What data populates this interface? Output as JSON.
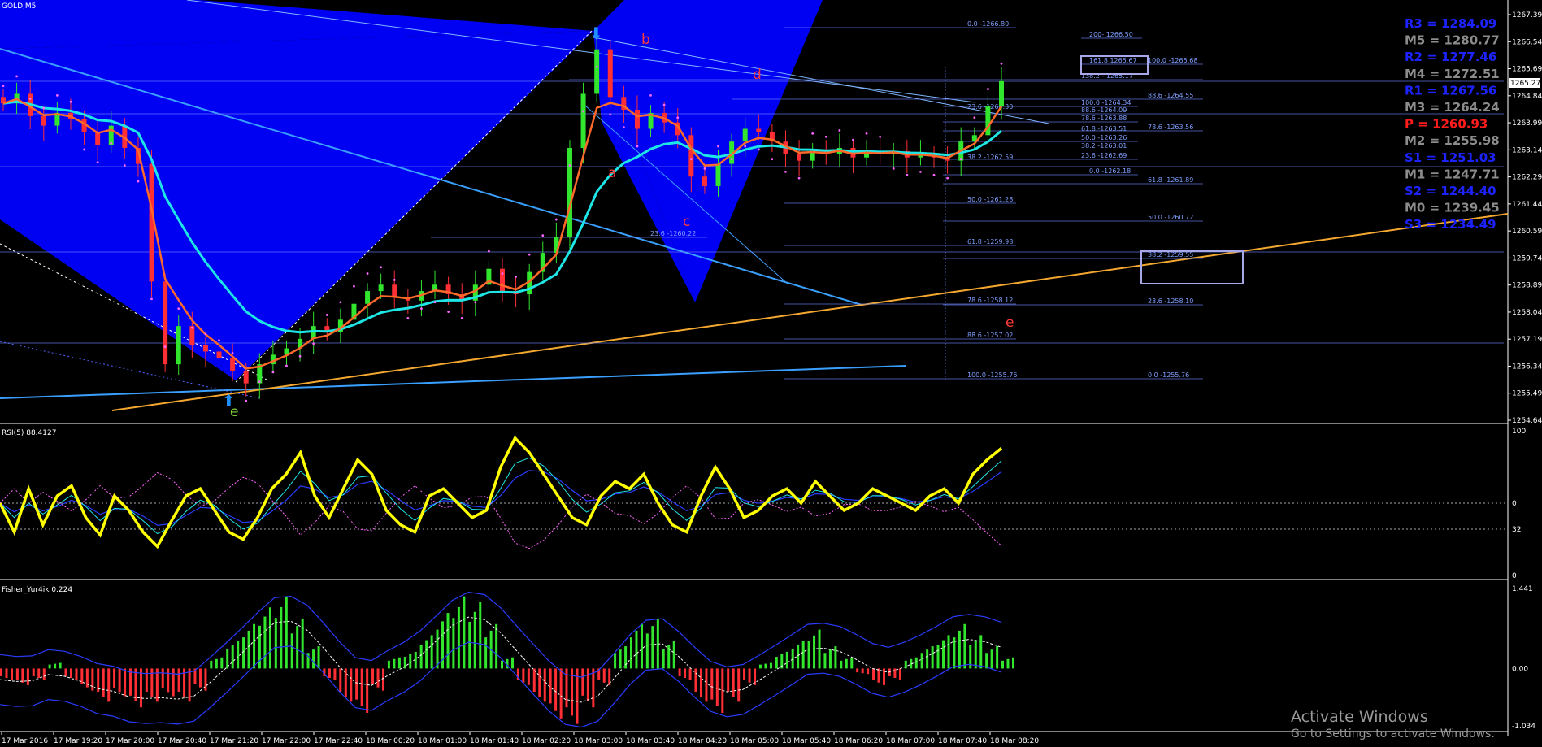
{
  "window": {
    "symbol_title": "GOLD,M5",
    "rsi_title": "RSI(5) 88.4127",
    "fisher_title": "Fisher_Yur4ik 0.224"
  },
  "watermark": {
    "line1": "Activate Windows",
    "line2": "Go to Settings to activate Windows."
  },
  "chart_data": [
    {
      "type": "candlestick",
      "symbol": "GOLD",
      "timeframe": "M5",
      "y_axis_ticks": [
        "1267.39",
        "1266.54",
        "1265.69",
        "1264.84",
        "1263.99",
        "1263.14",
        "1262.29",
        "1261.44",
        "1260.59",
        "1259.74",
        "1258.89",
        "1258.04",
        "1257.19",
        "1256.34",
        "1255.49",
        "1254.64"
      ],
      "ylim": [
        1254.64,
        1267.39
      ],
      "current_price_label": "1265.27",
      "x_tick_labels": [
        "17 Mar 2016",
        "17 Mar 19:20",
        "17 Mar 20:00",
        "17 Mar 20:40",
        "17 Mar 21:20",
        "17 Mar 22:00",
        "17 Mar 22:40",
        "18 Mar 00:20",
        "18 Mar 01:00",
        "18 Mar 01:40",
        "18 Mar 02:20",
        "18 Mar 03:00",
        "18 Mar 03:40",
        "18 Mar 04:20",
        "18 Mar 05:00",
        "18 Mar 05:40",
        "18 Mar 06:20",
        "18 Mar 07:00",
        "18 Mar 07:40",
        "18 Mar 08:20"
      ],
      "close_path": [
        1264.6,
        1264.9,
        1264.2,
        1263.9,
        1264.3,
        1264.1,
        1263.7,
        1263.3,
        1263.9,
        1263.2,
        1262.7,
        1259.0,
        1256.4,
        1257.6,
        1257.0,
        1256.8,
        1256.6,
        1256.2,
        1255.8,
        1256.4,
        1256.7,
        1256.9,
        1257.2,
        1257.6,
        1257.4,
        1257.8,
        1258.3,
        1258.7,
        1258.9,
        1258.5,
        1258.4,
        1258.7,
        1258.9,
        1258.6,
        1258.4,
        1258.9,
        1259.4,
        1258.7,
        1258.6,
        1259.3,
        1259.9,
        1260.4,
        1263.2,
        1264.9,
        1266.3,
        1264.8,
        1264.4,
        1263.8,
        1264.3,
        1264.0,
        1263.6,
        1262.3,
        1262.0,
        1262.7,
        1263.4,
        1263.8,
        1263.7,
        1263.4,
        1263.0,
        1262.8,
        1263.1,
        1263.0,
        1263.2,
        1262.9,
        1263.1,
        1263.0,
        1263.1,
        1262.9,
        1263.0,
        1262.9,
        1262.8,
        1263.4,
        1263.6,
        1264.5,
        1265.3
      ]
    },
    {
      "type": "line",
      "name": "RSI(5)",
      "value": 88.4127,
      "levels": [
        "100",
        "0",
        "32",
        "0"
      ],
      "ylim": [
        0,
        100
      ],
      "values": [
        50,
        30,
        60,
        35,
        55,
        62,
        40,
        28,
        55,
        45,
        30,
        20,
        38,
        55,
        60,
        45,
        30,
        25,
        40,
        60,
        70,
        85,
        55,
        40,
        60,
        80,
        70,
        45,
        35,
        30,
        55,
        60,
        50,
        40,
        45,
        75,
        95,
        85,
        70,
        55,
        40,
        35,
        55,
        65,
        60,
        70,
        50,
        35,
        30,
        55,
        75,
        60,
        40,
        45,
        55,
        60,
        50,
        65,
        55,
        45,
        50,
        60,
        55,
        50,
        45,
        55,
        60,
        50,
        70,
        80,
        88
      ]
    },
    {
      "type": "bar",
      "name": "Fisher_Yur4ik",
      "value": 0.224,
      "y_axis_ticks": [
        "1.441",
        "0.00",
        "-1.034"
      ],
      "ylim": [
        -1.034,
        1.441
      ],
      "values": [
        -0.2,
        -0.3,
        -0.2,
        0.1,
        -0.2,
        -0.4,
        -0.6,
        -0.5,
        -0.7,
        -0.6,
        -0.5,
        -0.6,
        -0.4,
        0.2,
        0.5,
        0.8,
        1.1,
        1.3,
        0.9,
        0.4,
        -0.2,
        -0.6,
        -0.8,
        -0.4,
        0.2,
        0.3,
        0.6,
        1.0,
        1.3,
        1.2,
        0.8,
        0.2,
        -0.3,
        -0.6,
        -0.9,
        -1.0,
        -0.7,
        -0.3,
        0.4,
        0.8,
        0.9,
        0.5,
        -0.2,
        -0.6,
        -0.8,
        -0.6,
        -0.3,
        0.1,
        0.3,
        0.5,
        0.7,
        0.4,
        0.2,
        -0.1,
        -0.3,
        -0.2,
        0.2,
        0.4,
        0.6,
        0.8,
        0.6,
        0.4,
        0.2
      ]
    }
  ],
  "pivots": [
    {
      "label": "R3 = 1284.09",
      "color": "#1d23ff"
    },
    {
      "label": "M5 = 1280.77",
      "color": "#8c8c8c"
    },
    {
      "label": "R2 = 1277.46",
      "color": "#1d23ff"
    },
    {
      "label": "M4 = 1272.51",
      "color": "#8c8c8c"
    },
    {
      "label": "R1 = 1267.56",
      "color": "#1d23ff"
    },
    {
      "label": "M3 = 1264.24",
      "color": "#8c8c8c"
    },
    {
      "label": "P  = 1260.93",
      "color": "#ff1c1c"
    },
    {
      "label": "M2 = 1255.98",
      "color": "#8c8c8c"
    },
    {
      "label": "S1 = 1251.03",
      "color": "#1d23ff"
    },
    {
      "label": "M1 = 1247.71",
      "color": "#8c8c8c"
    },
    {
      "label": "S2 = 1244.40",
      "color": "#1d23ff"
    },
    {
      "label": "M0 = 1239.45",
      "color": "#8c8c8c"
    },
    {
      "label": "S3 = 1234.49",
      "color": "#1d23ff"
    }
  ],
  "fib_labels": [
    "0.0 -1266.80",
    "200- 1266.50",
    "161.8 1265.67",
    "100.0 -1265.68",
    "138.2 - 1265.17",
    "88.6 -1264.55",
    "100.0 -1264.34",
    "88.6 -1264.09",
    "78.6 -1263.88",
    "61.8 -1263.51",
    "50.0 -1263.26",
    "38.2 -1263.01",
    "23.6 -1262.69",
    "78.6 -1263.56",
    "0.0 -1262.18",
    "61.8 -1261.89",
    "50.0 -1261.28",
    "50.0 -1260.72",
    "23.6 -1260.22",
    "61.8 -1259.98",
    "38.2 -1259.55",
    "78.6 -1258.12",
    "23.6 -1258.10",
    "88.6 -1257.02",
    "100.0 -1255.76",
    "0.0 -1255.76",
    "23.6 -1264.30",
    "38.2 -1262.59"
  ],
  "wave_labels": [
    "b",
    "d",
    "a",
    "c",
    "e",
    "e"
  ],
  "colors": {
    "background": "#000000",
    "bull": "#32e62e",
    "bear": "#ff2f35",
    "wedge": "#0000ff",
    "ma_fast": "#ff6a2a",
    "ma_slow": "#1ee6e6",
    "rsi": "#ffff00",
    "trendline": "#f5a830",
    "fib": "#6f86ff",
    "grid_text": "#ffffff"
  }
}
